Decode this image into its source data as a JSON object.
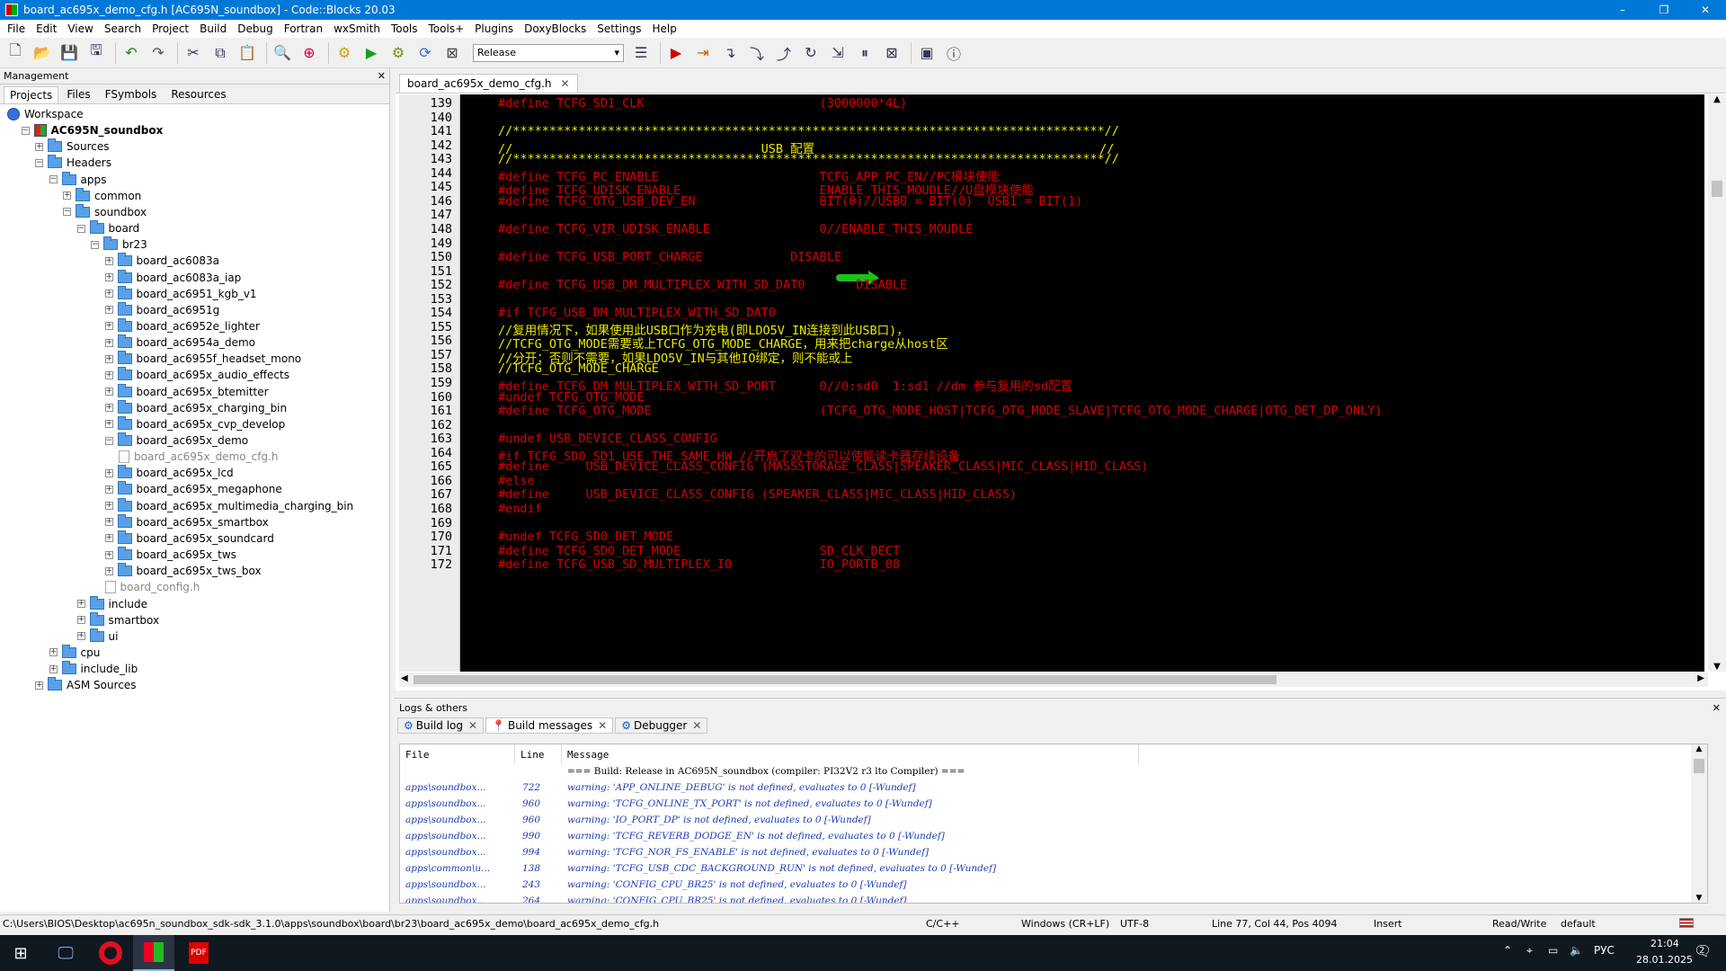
{
  "window": {
    "title": "board_ac695x_demo_cfg.h [AC695N_soundbox] - Code::Blocks 20.03",
    "controls": [
      "–",
      "❐",
      "✕"
    ]
  },
  "menu": [
    "File",
    "Edit",
    "View",
    "Search",
    "Project",
    "Build",
    "Debug",
    "Fortran",
    "wxSmith",
    "Tools",
    "Tools+",
    "Plugins",
    "DoxyBlocks",
    "Settings",
    "Help"
  ],
  "toolbar": {
    "build_target": "Release",
    "icons": [
      "new-file-icon",
      "open-file-icon",
      "save-icon",
      "save-all-icon",
      "undo-icon",
      "redo-icon",
      "cut-icon",
      "copy-icon",
      "paste-icon",
      "find-icon",
      "replace-icon",
      "build-icon",
      "run-icon",
      "build-run-icon",
      "rebuild-icon",
      "abort-icon",
      "build-target-icon",
      "debug-icon",
      "run-to-cursor-icon",
      "next-line-icon",
      "step-into-icon",
      "step-out-icon",
      "next-instruction-icon",
      "step-into-instruction-icon",
      "break-debugger-icon",
      "stop-debugger-icon",
      "debug-windows-icon",
      "info-icon"
    ]
  },
  "management": {
    "title": "Management",
    "close": "✕",
    "tabs": [
      "Projects",
      "Files",
      "FSymbols",
      "Resources"
    ],
    "tree": [
      {
        "label": "Workspace",
        "level": 0,
        "kind": "workspace"
      },
      {
        "label": "AC695N_soundbox",
        "level": 1,
        "kind": "project",
        "exp": "−"
      },
      {
        "label": "Sources",
        "level": 2,
        "kind": "folder",
        "exp": "+"
      },
      {
        "label": "Headers",
        "level": 2,
        "kind": "folder",
        "exp": "−"
      },
      {
        "label": "apps",
        "level": 3,
        "kind": "folder",
        "exp": "−"
      },
      {
        "label": "common",
        "level": 4,
        "kind": "folder",
        "exp": "+"
      },
      {
        "label": "soundbox",
        "level": 4,
        "kind": "folder",
        "exp": "−"
      },
      {
        "label": "board",
        "level": 5,
        "kind": "folder",
        "exp": "−"
      },
      {
        "label": "br23",
        "level": 6,
        "kind": "folder",
        "exp": "−"
      },
      {
        "label": "board_ac6083a",
        "level": 7,
        "kind": "folder",
        "exp": "+"
      },
      {
        "label": "board_ac6083a_iap",
        "level": 7,
        "kind": "folder",
        "exp": "+"
      },
      {
        "label": "board_ac6951_kgb_v1",
        "level": 7,
        "kind": "folder",
        "exp": "+"
      },
      {
        "label": "board_ac6951g",
        "level": 7,
        "kind": "folder",
        "exp": "+"
      },
      {
        "label": "board_ac6952e_lighter",
        "level": 7,
        "kind": "folder",
        "exp": "+"
      },
      {
        "label": "board_ac6954a_demo",
        "level": 7,
        "kind": "folder",
        "exp": "+"
      },
      {
        "label": "board_ac6955f_headset_mono",
        "level": 7,
        "kind": "folder",
        "exp": "+"
      },
      {
        "label": "board_ac695x_audio_effects",
        "level": 7,
        "kind": "folder",
        "exp": "+"
      },
      {
        "label": "board_ac695x_btemitter",
        "level": 7,
        "kind": "folder",
        "exp": "+"
      },
      {
        "label": "board_ac695x_charging_bin",
        "level": 7,
        "kind": "folder",
        "exp": "+"
      },
      {
        "label": "board_ac695x_cvp_develop",
        "level": 7,
        "kind": "folder",
        "exp": "+"
      },
      {
        "label": "board_ac695x_demo",
        "level": 7,
        "kind": "folder",
        "exp": "−"
      },
      {
        "label": "board_ac695x_demo_cfg.h",
        "level": 8,
        "kind": "file",
        "gray": true
      },
      {
        "label": "board_ac695x_lcd",
        "level": 7,
        "kind": "folder",
        "exp": "+"
      },
      {
        "label": "board_ac695x_megaphone",
        "level": 7,
        "kind": "folder",
        "exp": "+"
      },
      {
        "label": "board_ac695x_multimedia_charging_bin",
        "level": 7,
        "kind": "folder",
        "exp": "+"
      },
      {
        "label": "board_ac695x_smartbox",
        "level": 7,
        "kind": "folder",
        "exp": "+"
      },
      {
        "label": "board_ac695x_soundcard",
        "level": 7,
        "kind": "folder",
        "exp": "+"
      },
      {
        "label": "board_ac695x_tws",
        "level": 7,
        "kind": "folder",
        "exp": "+"
      },
      {
        "label": "board_ac695x_tws_box",
        "level": 7,
        "kind": "folder",
        "exp": "+"
      },
      {
        "label": "board_config.h",
        "level": 7,
        "kind": "file",
        "gray": true
      },
      {
        "label": "include",
        "level": 5,
        "kind": "folder",
        "exp": "+"
      },
      {
        "label": "smartbox",
        "level": 5,
        "kind": "folder",
        "exp": "+"
      },
      {
        "label": "ui",
        "level": 5,
        "kind": "folder",
        "exp": "+"
      },
      {
        "label": "cpu",
        "level": 3,
        "kind": "folder",
        "exp": "+"
      },
      {
        "label": "include_lib",
        "level": 3,
        "kind": "folder",
        "exp": "+"
      },
      {
        "label": "ASM Sources",
        "level": 2,
        "kind": "folder",
        "exp": "+"
      }
    ]
  },
  "editor": {
    "tab": "board_ac695x_demo_cfg.h",
    "lines": [
      {
        "n": "139",
        "t": "#define TCFG_SD1_CLK                        (3000000*4L)"
      },
      {
        "n": "140",
        "t": ""
      },
      {
        "n": "141",
        "t": "//*********************************************************************************//",
        "y": true
      },
      {
        "n": "142",
        "t": "//                                  USB 配置                                       //",
        "y": true
      },
      {
        "n": "143",
        "t": "//*********************************************************************************//",
        "y": true
      },
      {
        "n": "144",
        "t": "#define TCFG_PC_ENABLE                      TCFG_APP_PC_EN//PC模块使能"
      },
      {
        "n": "145",
        "t": "#define TCFG_UDISK_ENABLE                   ENABLE_THIS_MOUDLE//U盘模块使能"
      },
      {
        "n": "146",
        "t": "#define TCFG_OTG_USB_DEV_EN                 BIT(0)//USB0 = BIT(0)  USB1 = BIT(1)"
      },
      {
        "n": "147",
        "t": ""
      },
      {
        "n": "148",
        "t": "#define TCFG_VIR_UDISK_ENABLE               0//ENABLE_THIS_MOUDLE"
      },
      {
        "n": "149",
        "t": ""
      },
      {
        "n": "150",
        "t": "#define TCFG_USB_PORT_CHARGE            DISABLE"
      },
      {
        "n": "151",
        "t": ""
      },
      {
        "n": "152",
        "t": "#define TCFG_USB_DM_MULTIPLEX_WITH_SD_DAT0       DISABLE"
      },
      {
        "n": "153",
        "t": ""
      },
      {
        "n": "154",
        "t": "#if TCFG_USB_DM_MULTIPLEX_WITH_SD_DAT0"
      },
      {
        "n": "155",
        "t": "//复用情况下，如果使用此USB口作为充电(即LDO5V_IN连接到此USB口)，",
        "y": true
      },
      {
        "n": "156",
        "t": "//TCFG_OTG_MODE需要或上TCFG_OTG_MODE_CHARGE，用来把charge从host区",
        "y": true
      },
      {
        "n": "157",
        "t": "//分开；否则不需要，如果LDO5V_IN与其他IO绑定，则不能或上",
        "y": true
      },
      {
        "n": "158",
        "t": "//TCFG_OTG_MODE_CHARGE",
        "y": true
      },
      {
        "n": "159",
        "t": "#define TCFG_DM_MULTIPLEX_WITH_SD_PORT      0//0:sd0  1:sd1 //dm 参与复用的sd配置"
      },
      {
        "n": "160",
        "t": "#undef TCFG_OTG_MODE"
      },
      {
        "n": "161",
        "t": "#define TCFG_OTG_MODE                       (TCFG_OTG_MODE_HOST|TCFG_OTG_MODE_SLAVE|TCFG_OTG_MODE_CHARGE|OTG_DET_DP_ONLY)"
      },
      {
        "n": "162",
        "t": ""
      },
      {
        "n": "163",
        "t": "#undef USB_DEVICE_CLASS_CONFIG"
      },
      {
        "n": "164",
        "t": "#if TCFG_SD0_SD1_USE_THE_SAME_HW //开启了双卡的可以使能读卡器存续设备"
      },
      {
        "n": "165",
        "t": "#define     USB_DEVICE_CLASS_CONFIG (MASSSTORAGE_CLASS|SPEAKER_CLASS|MIC_CLASS|HID_CLASS)"
      },
      {
        "n": "166",
        "t": "#else"
      },
      {
        "n": "167",
        "t": "#define     USB_DEVICE_CLASS_CONFIG (SPEAKER_CLASS|MIC_CLASS|HID_CLASS)"
      },
      {
        "n": "168",
        "t": "#endif"
      },
      {
        "n": "169",
        "t": ""
      },
      {
        "n": "170",
        "t": "#undef TCFG_SD0_DET_MODE"
      },
      {
        "n": "171",
        "t": "#define TCFG_SD0_DET_MODE                   SD_CLK_DECT"
      },
      {
        "n": "172",
        "t": "#define TCFG_USB_SD_MULTIPLEX_IO            IO_PORTB_08"
      }
    ]
  },
  "logs": {
    "title": "Logs & others",
    "close": "✕",
    "tabs": [
      {
        "label": "Build log",
        "icon": "gear"
      },
      {
        "label": "Build messages",
        "icon": "pin"
      },
      {
        "label": "Debugger",
        "icon": "gear"
      }
    ],
    "headers": [
      "File",
      "Line",
      "Message"
    ],
    "build_line": "=== Build: Release in AC695N_soundbox (compiler: PI32V2 r3 lto Compiler) ===",
    "rows": [
      {
        "file": "apps\\soundbox...",
        "line": "722",
        "msg": "warning: 'APP_ONLINE_DEBUG' is not defined, evaluates to 0 [-Wundef]"
      },
      {
        "file": "apps\\soundbox...",
        "line": "960",
        "msg": "warning: 'TCFG_ONLINE_TX_PORT' is not defined, evaluates to 0 [-Wundef]"
      },
      {
        "file": "apps\\soundbox...",
        "line": "960",
        "msg": "warning: 'IO_PORT_DP' is not defined, evaluates to 0 [-Wundef]"
      },
      {
        "file": "apps\\soundbox...",
        "line": "990",
        "msg": "warning: 'TCFG_REVERB_DODGE_EN' is not defined, evaluates to 0 [-Wundef]"
      },
      {
        "file": "apps\\soundbox...",
        "line": "994",
        "msg": "warning: 'TCFG_NOR_FS_ENABLE' is not defined, evaluates to 0 [-Wundef]"
      },
      {
        "file": "apps\\common\\u...",
        "line": "138",
        "msg": "warning: 'TCFG_USB_CDC_BACKGROUND_RUN' is not defined, evaluates to 0 [-Wundef]"
      },
      {
        "file": "apps\\soundbox...",
        "line": "243",
        "msg": "warning: 'CONFIG_CPU_BR25' is not defined, evaluates to 0 [-Wundef]"
      },
      {
        "file": "apps\\soundbox...",
        "line": "264",
        "msg": "warning: 'CONFIG_CPU_BR25' is not defined, evaluates to 0 [-Wundef]"
      }
    ]
  },
  "status": {
    "path": "C:\\Users\\BIOS\\Desktop\\ac695n_soundbox_sdk-sdk_3.1.0\\apps\\soundbox\\board\\br23\\board_ac695x_demo\\board_ac695x_demo_cfg.h",
    "lang": "C/C++",
    "eol": "Windows (CR+LF)",
    "encoding": "UTF-8",
    "position": "Line 77, Col 44, Pos 4094",
    "mode": "Insert",
    "access": "Read/Write",
    "profile": "default"
  },
  "taskbar": {
    "lang": "РУС",
    "time": "21:04",
    "date": "28.01.2025",
    "notifications": "2",
    "tray_icons": [
      "chevron-up-icon",
      "location-icon",
      "network-icon",
      "volume-icon"
    ]
  },
  "colors": {
    "accent": "#0078d7",
    "code_bg": "#000000",
    "preproc": "#d50000",
    "comment": "#e8e800",
    "warn": "#1c3cb8"
  }
}
